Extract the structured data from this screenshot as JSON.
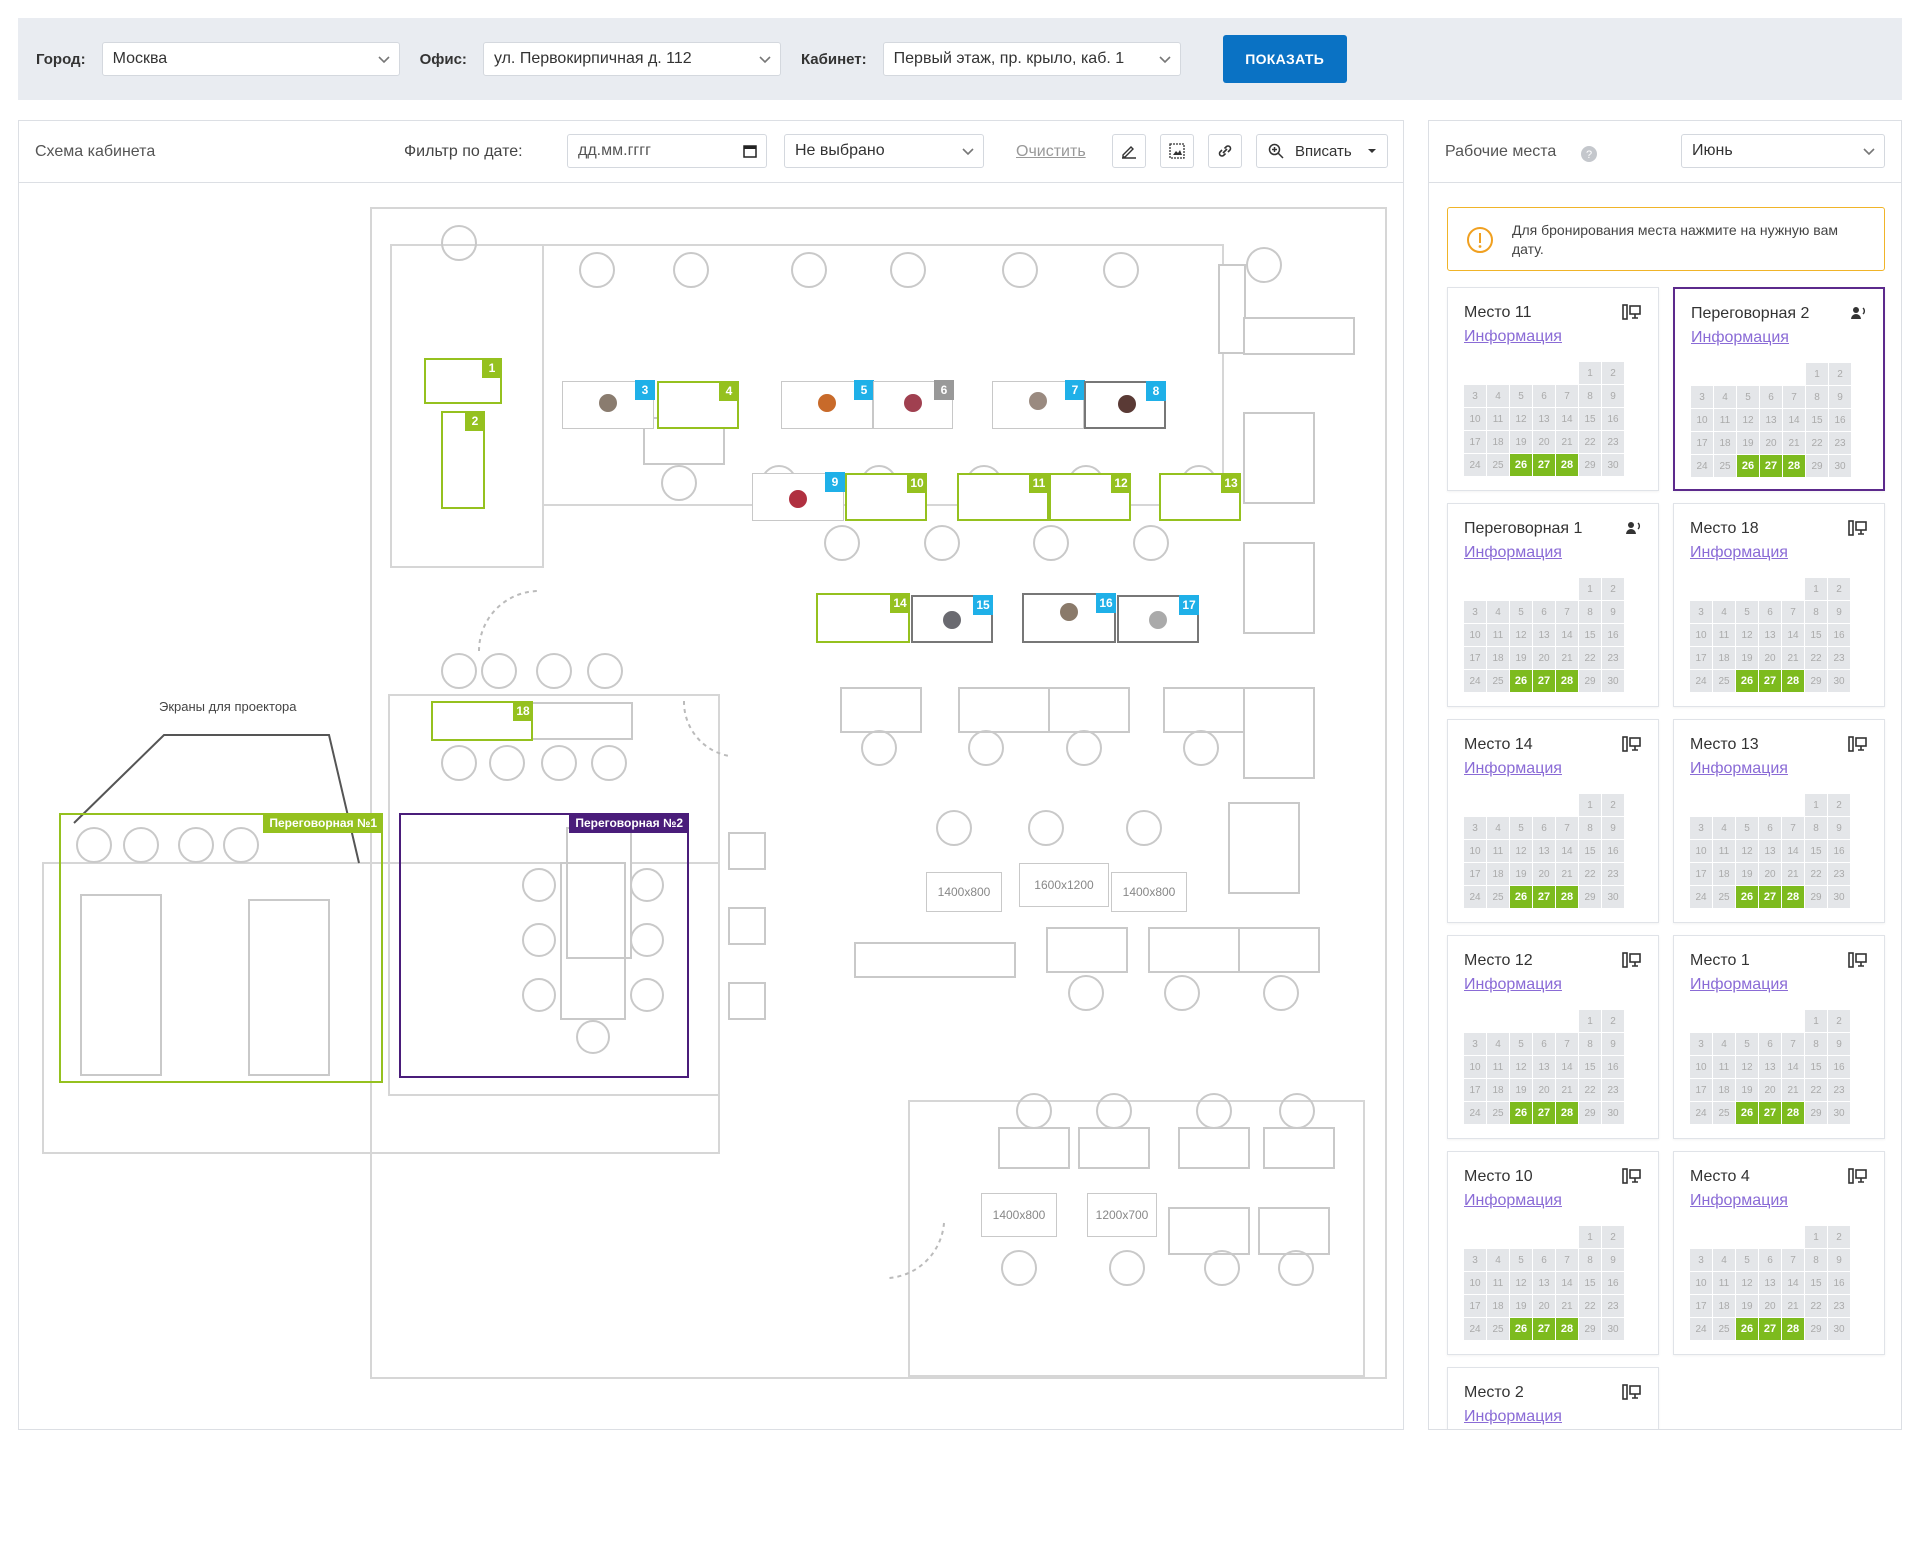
{
  "topbar": {
    "city_label": "Город:",
    "city_value": "Москва",
    "office_label": "Офис:",
    "office_value": "ул. Первокирпичная д. 112",
    "cabinet_label": "Кабинет:",
    "cabinet_value": "Первый этаж, пр. крыло, каб. 1",
    "show_button": "ПОКАЗАТЬ"
  },
  "scheme": {
    "title": "Схема кабинета",
    "date_filter_label": "Фильтр по дате:",
    "date_placeholder": "дд.мм.гггг",
    "status_select": "Не выбрано",
    "clear_link": "Очистить",
    "zoom_label": "Вписать",
    "screens_label": "Экраны для проектора",
    "room1_label": "Переговорная №1",
    "room2_label": "Переговорная №2",
    "table_sizes": [
      "1400x800",
      "1600x1200",
      "1400x800",
      "1400x800",
      "1200x700"
    ],
    "seats": [
      {
        "n": "1",
        "state": "free"
      },
      {
        "n": "2",
        "state": "free"
      },
      {
        "n": "3",
        "state": "occupied"
      },
      {
        "n": "4",
        "state": "free"
      },
      {
        "n": "5",
        "state": "occupied"
      },
      {
        "n": "6",
        "state": "inactive"
      },
      {
        "n": "7",
        "state": "occupied"
      },
      {
        "n": "8",
        "state": "occupied"
      },
      {
        "n": "9",
        "state": "occupied"
      },
      {
        "n": "10",
        "state": "free"
      },
      {
        "n": "11",
        "state": "free"
      },
      {
        "n": "12",
        "state": "free"
      },
      {
        "n": "13",
        "state": "free"
      },
      {
        "n": "14",
        "state": "free"
      },
      {
        "n": "15",
        "state": "occupied"
      },
      {
        "n": "16",
        "state": "occupied"
      },
      {
        "n": "17",
        "state": "occupied"
      },
      {
        "n": "18",
        "state": "free"
      }
    ],
    "colors": {
      "free": "#95c11f",
      "occupied": "#1fb0e8",
      "inactive": "#999999",
      "meeting2": "#4a1d7a"
    }
  },
  "workplaces": {
    "title": "Рабочие места",
    "help_icon": "question-icon",
    "month": "Июнь",
    "notice": "Для бронирования места нажмите на нужную вам дату.",
    "calendar_days": [
      "1",
      "2",
      "3",
      "4",
      "5",
      "6",
      "7",
      "8",
      "9",
      "10",
      "11",
      "12",
      "13",
      "14",
      "15",
      "16",
      "17",
      "18",
      "19",
      "20",
      "21",
      "22",
      "23",
      "24",
      "25",
      "26",
      "27",
      "28",
      "29",
      "30"
    ],
    "available_days": [
      "26",
      "27",
      "28"
    ],
    "cards": [
      {
        "name": "Место 11",
        "link": "Информация",
        "icon": "desk-icon"
      },
      {
        "name": "Переговорная 2",
        "link": "Информация",
        "icon": "meeting-room-icon"
      },
      {
        "name": "Переговорная 1",
        "link": "Информация",
        "icon": "meeting-room-icon"
      },
      {
        "name": "Место 18",
        "link": "Информация",
        "icon": "desk-icon"
      },
      {
        "name": "Место 14",
        "link": "Информация",
        "icon": "desk-icon"
      },
      {
        "name": "Место 13",
        "link": "Информация",
        "icon": "desk-icon"
      },
      {
        "name": "Место 12",
        "link": "Информация",
        "icon": "desk-icon"
      },
      {
        "name": "Место 1",
        "link": "Информация",
        "icon": "desk-icon"
      },
      {
        "name": "Место 10",
        "link": "Информация",
        "icon": "desk-icon"
      },
      {
        "name": "Место 4",
        "link": "Информация",
        "icon": "desk-icon"
      },
      {
        "name": "Место 2",
        "link": "Информация",
        "icon": "desk-icon"
      }
    ]
  }
}
